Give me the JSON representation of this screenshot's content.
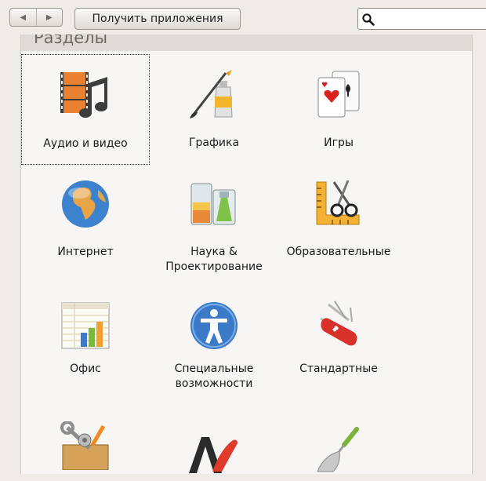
{
  "toolbar": {
    "back_glyph": "◀",
    "forward_glyph": "▶",
    "get_apps_label": "Получить приложения",
    "search_value": ""
  },
  "section": {
    "title": "Разделы"
  },
  "categories": [
    {
      "label": "Аудио и видео",
      "icon": "audio-video-icon",
      "focused": true
    },
    {
      "label": "Графика",
      "icon": "graphics-icon"
    },
    {
      "label": "Игры",
      "icon": "games-cards-icon"
    },
    {
      "label": "Интернет",
      "icon": "globe-icon"
    },
    {
      "label": "Наука &\nПроектирование",
      "icon": "lab-beaker-icon"
    },
    {
      "label": "Образовательные",
      "icon": "education-ruler-scissors-icon"
    },
    {
      "label": "Офис",
      "icon": "office-spreadsheet-icon"
    },
    {
      "label": "Специальные\nвозможности",
      "icon": "accessibility-icon"
    },
    {
      "label": "Стандартные",
      "icon": "swiss-knife-icon"
    },
    {
      "label": "",
      "icon": "system-tools-icon"
    },
    {
      "label": "",
      "icon": "fonts-icon"
    },
    {
      "label": "",
      "icon": "trowel-icon"
    }
  ],
  "colors": {
    "window_bg": "#efebe7",
    "panel_bg": "#f7f6f5",
    "header_bg": "#dedbd6",
    "header_text": "#6c6862"
  }
}
